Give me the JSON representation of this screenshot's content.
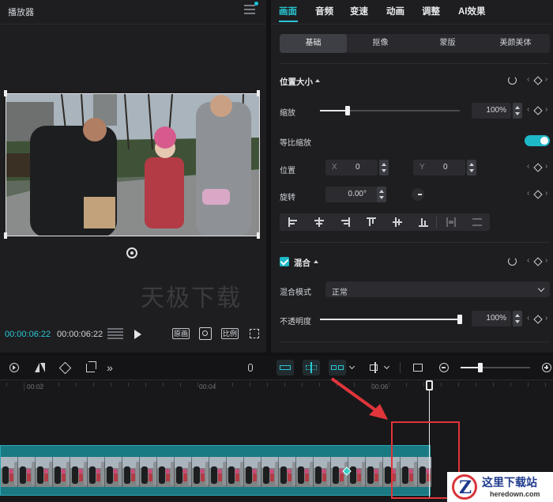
{
  "player": {
    "title": "播放器",
    "time_current": "00:00:06:22",
    "time_total": "00:00:06:22",
    "btn_original": "原画",
    "btn_ratio": "比例"
  },
  "props": {
    "tabs": [
      "画面",
      "音频",
      "变速",
      "动画",
      "调整",
      "AI效果"
    ],
    "active_tab": "画面",
    "subtabs": [
      "基础",
      "抠像",
      "蒙版",
      "美颜美体"
    ],
    "position_size": {
      "section": "位置大小",
      "scale_label": "缩放",
      "scale_value": "100%",
      "scale_fraction": 0.2,
      "uniform_label": "等比缩放",
      "position_label": "位置",
      "x_label": "X",
      "x_value": "0",
      "y_label": "Y",
      "y_value": "0",
      "rotate_label": "旋转",
      "rotate_value": "0.00°"
    },
    "blend": {
      "section": "混合",
      "mode_label": "混合模式",
      "mode_value": "正常",
      "opacity_label": "不透明度",
      "opacity_value": "100%",
      "opacity_fraction": 1.0
    }
  },
  "timeline": {
    "ruler": [
      "00:02",
      "00:04",
      "00:06"
    ]
  },
  "watermark": "天极下载",
  "badge": {
    "title": "这里下载站",
    "url": "heredown.com",
    "logo_letter": "Z"
  },
  "colors": {
    "accent": "#29c7d3",
    "track": "#197a84",
    "highlight": "#e0353a"
  }
}
